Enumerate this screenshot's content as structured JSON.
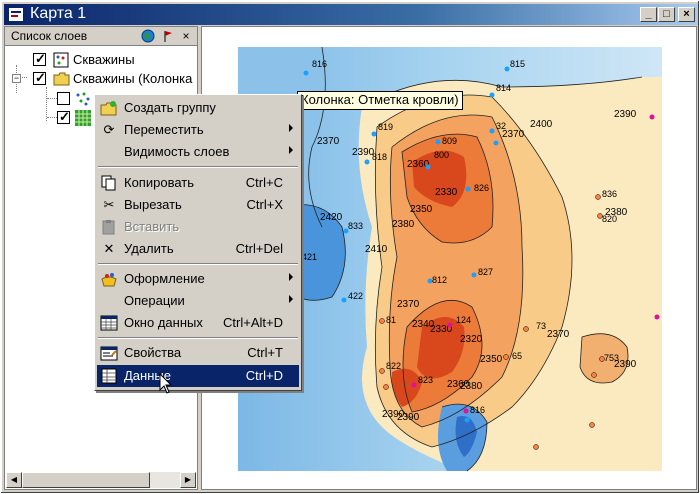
{
  "window": {
    "title": "Карта 1",
    "minimize": "_",
    "maximize": "□",
    "close": "×"
  },
  "layers_panel": {
    "title": "Список слоев",
    "items": [
      {
        "label": "Скважины",
        "checked": true,
        "icon": "wells-icon"
      },
      {
        "label": "Скважины (Колонка",
        "checked": true,
        "icon": "folder-icon"
      },
      {
        "label": "",
        "checked": false,
        "icon": "points-layer-icon"
      },
      {
        "label": "",
        "checked": true,
        "icon": "grid-layer-icon"
      }
    ]
  },
  "tooltip": "Колонка: Отметка кровли)",
  "context_menu": [
    {
      "label": "Создать группу",
      "shortcut": "",
      "icon": "create-group-icon",
      "submenu": false,
      "disabled": false
    },
    {
      "label": "Переместить",
      "shortcut": "",
      "icon": "move-icon",
      "submenu": true,
      "disabled": false
    },
    {
      "label": "Видимость слоев",
      "shortcut": "",
      "icon": "",
      "submenu": true,
      "disabled": false
    },
    {
      "label": "Копировать",
      "shortcut": "Ctrl+C",
      "icon": "copy-icon",
      "submenu": false,
      "disabled": false
    },
    {
      "label": "Вырезать",
      "shortcut": "Ctrl+X",
      "icon": "cut-icon",
      "submenu": false,
      "disabled": false
    },
    {
      "label": "Вставить",
      "shortcut": "",
      "icon": "paste-icon",
      "submenu": false,
      "disabled": true
    },
    {
      "label": "Удалить",
      "shortcut": "Ctrl+Del",
      "icon": "delete-icon",
      "submenu": false,
      "disabled": false
    },
    {
      "label": "Оформление",
      "shortcut": "",
      "icon": "style-icon",
      "submenu": true,
      "disabled": false
    },
    {
      "label": "Операции",
      "shortcut": "",
      "icon": "",
      "submenu": true,
      "disabled": false
    },
    {
      "label": "Окно данных",
      "shortcut": "Ctrl+Alt+D",
      "icon": "data-window-icon",
      "submenu": false,
      "disabled": false
    },
    {
      "label": "Свойства",
      "shortcut": "Ctrl+T",
      "icon": "properties-icon",
      "submenu": false,
      "disabled": false
    },
    {
      "label": "Данные",
      "shortcut": "Ctrl+D",
      "icon": "data-icon",
      "submenu": false,
      "disabled": false,
      "selected": true
    }
  ],
  "map": {
    "contour_labels": [
      "2400",
      "2390",
      "2370",
      "2390",
      "2360",
      "2330",
      "2350",
      "2380",
      "2420",
      "2410",
      "2370",
      "2340",
      "2330",
      "2320",
      "2350",
      "2360",
      "2380",
      "2390",
      "2370",
      "2380",
      "2390",
      "2390",
      "2370"
    ],
    "well_labels": [
      "816",
      "815",
      "814",
      "819",
      "818",
      "809",
      "800",
      "32",
      "826",
      "836",
      "820",
      "833",
      "421",
      "422",
      "812",
      "827",
      "124",
      "81",
      "73",
      "65",
      "753",
      "822",
      "823",
      "816"
    ]
  }
}
